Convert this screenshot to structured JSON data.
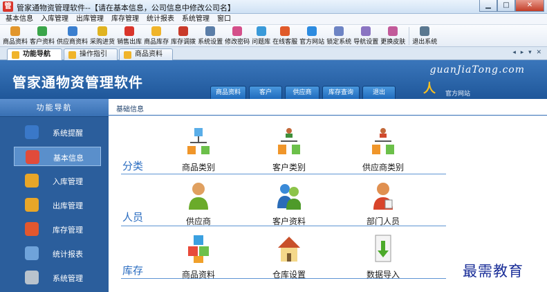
{
  "window": {
    "title": "管家通物资管理软件--【请在基本信息，公司信息中修改公司名】",
    "app_icon": "管",
    "min_label": "▁",
    "max_label": "□",
    "close_label": "✕"
  },
  "menu": [
    "基本信息",
    "入库管理",
    "出库管理",
    "库存管理",
    "统计报表",
    "系统管理",
    "窗口"
  ],
  "toolbar": [
    {
      "label": "商品资料",
      "icon": "goods-icon",
      "color": "#e2962c"
    },
    {
      "label": "客户资料",
      "icon": "customer-icon",
      "color": "#3aa54a"
    },
    {
      "label": "供应商资料",
      "icon": "supplier-icon",
      "color": "#3b7fcf"
    },
    {
      "label": "采购进货",
      "icon": "purchase-icon",
      "color": "#e0b320"
    },
    {
      "label": "销售出库",
      "icon": "sales-icon",
      "color": "#d9352b"
    },
    {
      "label": "商品库存",
      "icon": "stock-icon",
      "color": "#f0b42a"
    },
    {
      "label": "库存调拨",
      "icon": "transfer-icon",
      "color": "#c93a2a"
    },
    {
      "label": "系统设置",
      "icon": "settings-icon",
      "color": "#5b7ea8"
    },
    {
      "label": "修改密码",
      "icon": "password-icon",
      "color": "#d44f8a"
    },
    {
      "label": "问题库",
      "icon": "faq-icon",
      "color": "#3a9ad9"
    },
    {
      "label": "在线客服",
      "icon": "service-icon",
      "color": "#e05a2a"
    },
    {
      "label": "官方网站",
      "icon": "website-icon",
      "color": "#2c8be0"
    },
    {
      "label": "锁定系统",
      "icon": "lock-icon",
      "color": "#6d84c4"
    },
    {
      "label": "导航设置",
      "icon": "nav-settings-icon",
      "color": "#8a74c2"
    },
    {
      "label": "更换皮肤",
      "icon": "skin-icon",
      "color": "#c25a9a"
    },
    {
      "label": "退出系统",
      "icon": "exit-icon",
      "color": "#5a7890"
    }
  ],
  "tabs": [
    {
      "label": "功能导航",
      "active": true
    },
    {
      "label": "操作指引",
      "active": false
    },
    {
      "label": "商品资料",
      "active": false
    }
  ],
  "tab_nav": "◂ ▸ ▾ ✕",
  "header": {
    "product_name": "管家通物资管理软件",
    "brand": "guanJiaTong.com",
    "tabs": [
      "商品资料",
      "客户",
      "供应商",
      "库存查询",
      "退出"
    ],
    "site_icon": "人",
    "site_label": "官方网站"
  },
  "sidebar": {
    "title": "功能导航",
    "items": [
      {
        "label": "系统提醒",
        "icon": "info-icon",
        "color": "#3a78c8"
      },
      {
        "label": "基本信息",
        "icon": "basic-info-icon",
        "color": "#e14b3a"
      },
      {
        "label": "入库管理",
        "icon": "stock-in-icon",
        "color": "#e8a628"
      },
      {
        "label": "出库管理",
        "icon": "stock-out-icon",
        "color": "#e8a628"
      },
      {
        "label": "库存管理",
        "icon": "inventory-icon",
        "color": "#e2572e"
      },
      {
        "label": "统计报表",
        "icon": "report-icon",
        "color": "#6fa3da"
      },
      {
        "label": "系统管理",
        "icon": "system-icon",
        "color": "#b9c3cd"
      }
    ],
    "active_index": 1
  },
  "content": {
    "title": "基础信息",
    "sections": [
      {
        "label": "分类",
        "modules": [
          {
            "label": "商品类别",
            "icon": "category-tree-icon"
          },
          {
            "label": "客户类别",
            "icon": "customer-category-icon"
          },
          {
            "label": "供应商类别",
            "icon": "supplier-category-icon"
          }
        ]
      },
      {
        "label": "人员",
        "modules": [
          {
            "label": "供应商",
            "icon": "supplier-person-icon"
          },
          {
            "label": "客户资料",
            "icon": "customer-group-icon"
          },
          {
            "label": "部门人员",
            "icon": "staff-icon"
          }
        ]
      },
      {
        "label": "库存",
        "modules": [
          {
            "label": "商品资料",
            "icon": "goods-cubes-icon"
          },
          {
            "label": "仓库设置",
            "icon": "warehouse-house-icon"
          },
          {
            "label": "数据导入",
            "icon": "data-import-icon"
          }
        ]
      }
    ]
  },
  "watermark": "最需教育"
}
